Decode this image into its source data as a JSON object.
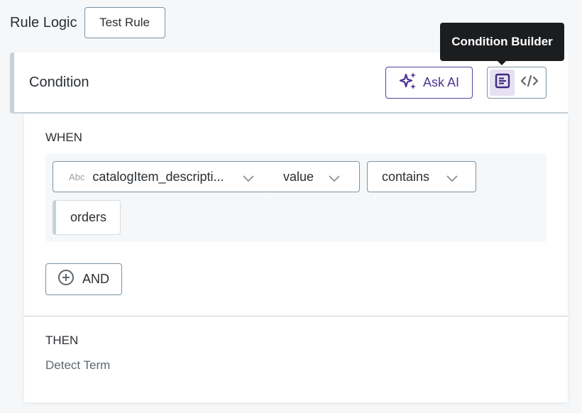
{
  "header": {
    "title": "Rule Logic",
    "test_rule_label": "Test Rule"
  },
  "condition": {
    "title": "Condition",
    "ask_ai_label": "Ask AI",
    "view_toggle": {
      "builder_icon": "list-form-icon",
      "code_icon": "code-icon",
      "active": "builder"
    },
    "tooltip": "Condition Builder",
    "when_label": "WHEN",
    "field_select": {
      "type_badge": "Abc",
      "value": "catalogItem_descripti..."
    },
    "property_select": {
      "value": "value"
    },
    "operator_select": {
      "value": "contains"
    },
    "value_input": {
      "value": "orders"
    },
    "and_button_label": "AND",
    "then_label": "THEN",
    "then_value": "Detect Term"
  },
  "colors": {
    "accent": "#4c3591",
    "accent_bg": "#e6e0f3",
    "border": "#7d93a1",
    "tooltip_bg": "#1c1d1f",
    "page_bg": "#f5f7f9"
  }
}
